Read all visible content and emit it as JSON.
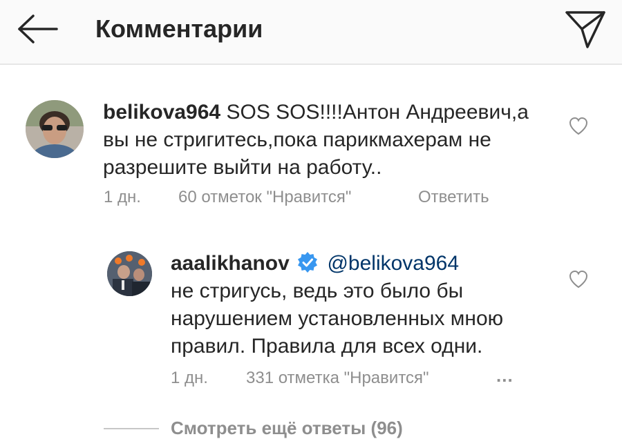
{
  "header": {
    "title": "Комментарии",
    "back_icon": "arrow-left-icon",
    "send_icon": "paper-plane-icon"
  },
  "comments": [
    {
      "username": "belikova964",
      "text": "SOS SOS!!!!Антон Андреевич,а вы не стригитесь,пока парикмахерам не разрешите выйти на работу..",
      "time": "1 дн.",
      "likes": "60 отметок \"Нравится\"",
      "reply": "Ответить"
    },
    {
      "username": "aaalikhanov",
      "verified": true,
      "mention": "@belikova964",
      "text": "не стригусь, ведь это было бы нарушением установленных мною правил. Правила для всех одни.",
      "time": "1 дн.",
      "likes": "331 отметка \"Нравится\"",
      "more": "..."
    }
  ],
  "view_more": "Смотреть ещё ответы (96)",
  "colors": {
    "text": "#262626",
    "secondary": "#8e8e8e",
    "mention": "#003569",
    "verified": "#3897f0",
    "header_bg": "#fafafa"
  }
}
